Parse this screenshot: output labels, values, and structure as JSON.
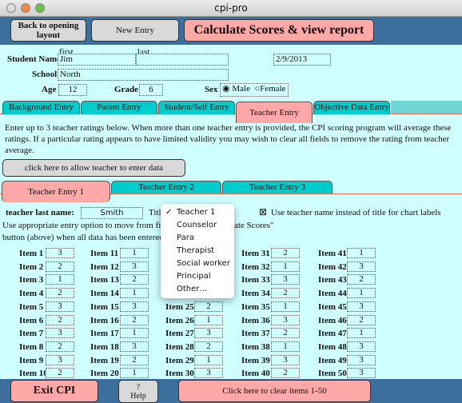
{
  "window": {
    "title": "cpi-pro"
  },
  "toolbar": {
    "back_label": "Back to opening layout",
    "new_label": "New Entry",
    "calc_label": "Calculate Scores & view report"
  },
  "student": {
    "name_label": "Student Name",
    "first_hint": "first",
    "last_hint": "last",
    "first": "Jim",
    "last": "",
    "date": "2/9/2013",
    "school_label": "School",
    "school": "North",
    "age_label": "Age",
    "age": "12",
    "grade_label": "Grade",
    "grade": "6",
    "sex_label": "Sex",
    "sex_options": [
      "Male",
      "Female"
    ],
    "sex_selected": "Male"
  },
  "tabs": [
    "Background Entry",
    "Parent Entry",
    "Student/Self Entry",
    "Teacher Entry",
    "Objective Data Entry"
  ],
  "active_tab": "Teacher Entry",
  "instructions": "Enter up to 3 teacher ratings below.  When more than one teacher entry is provided, the CPI scoring program will average these ratings.  If a particular rating appears to have limited validity you may wish to clear all fields to remove the rating from teacher average.",
  "allow_button": "click here to allow teacher to enter data",
  "subtabs": [
    "Teacher Entry 1",
    "Teacher Entry 2",
    "Teacher Entry 3"
  ],
  "teacher": {
    "last_name_label": "teacher last name:",
    "last_name": "Smith",
    "title_label": "Titl",
    "use_name_checked": true,
    "use_name_label": "Use teacher name instead of title for chart labels",
    "note_line1": "Use appropriate entry option to move from field",
    "note_line1_end": "ate Scores\"",
    "note_line2": "button (above) when all data has been entered."
  },
  "title_dropdown": {
    "selected": "Teacher 1",
    "options": [
      "Teacher 1",
      "Counselor",
      "Para",
      "Therapist",
      "Social worker",
      "Principal",
      "Other…"
    ]
  },
  "items": [
    {
      "label": "Item 1",
      "value": "3"
    },
    {
      "label": "Item 2",
      "value": "2"
    },
    {
      "label": "Item 3",
      "value": "1"
    },
    {
      "label": "Item 4",
      "value": "2"
    },
    {
      "label": "Item 5",
      "value": "3"
    },
    {
      "label": "Item 6",
      "value": "2"
    },
    {
      "label": "Item 7",
      "value": "3"
    },
    {
      "label": "Item 8",
      "value": "2"
    },
    {
      "label": "Item 9",
      "value": "3"
    },
    {
      "label": "Item 10",
      "value": "2"
    },
    {
      "label": "Item 11",
      "value": "1"
    },
    {
      "label": "Item 12",
      "value": "3"
    },
    {
      "label": "Item 13",
      "value": "2"
    },
    {
      "label": "Item 14",
      "value": "1"
    },
    {
      "label": "Item 15",
      "value": "3"
    },
    {
      "label": "Item 16",
      "value": "2"
    },
    {
      "label": "Item 17",
      "value": "1"
    },
    {
      "label": "Item 18",
      "value": "3"
    },
    {
      "label": "Item 19",
      "value": "2"
    },
    {
      "label": "Item 20",
      "value": "1"
    },
    {
      "label": "Item 25",
      "value": "2"
    },
    {
      "label": "Item 26",
      "value": "1"
    },
    {
      "label": "Item 27",
      "value": "3"
    },
    {
      "label": "Item 28",
      "value": "2"
    },
    {
      "label": "Item 29",
      "value": "1"
    },
    {
      "label": "Item 30",
      "value": "3"
    },
    {
      "label": "Item 31",
      "value": "2"
    },
    {
      "label": "Item 32",
      "value": "1"
    },
    {
      "label": "Item 33",
      "value": "3"
    },
    {
      "label": "Item 34",
      "value": "2"
    },
    {
      "label": "Item 35",
      "value": "1"
    },
    {
      "label": "Item 36",
      "value": "3"
    },
    {
      "label": "Item 37",
      "value": "2"
    },
    {
      "label": "Item 38",
      "value": "1"
    },
    {
      "label": "Item 39",
      "value": "3"
    },
    {
      "label": "Item 40",
      "value": "2"
    },
    {
      "label": "Item 41",
      "value": "1"
    },
    {
      "label": "Item 42",
      "value": "3"
    },
    {
      "label": "Item 43",
      "value": "2"
    },
    {
      "label": "Item 44",
      "value": "1"
    },
    {
      "label": "Item 45",
      "value": "3"
    },
    {
      "label": "Item 46",
      "value": "2"
    },
    {
      "label": "Item 47",
      "value": "1"
    },
    {
      "label": "Item 48",
      "value": "3"
    },
    {
      "label": "Item 49",
      "value": "3"
    },
    {
      "label": "Item 50",
      "value": "3"
    }
  ],
  "bottom": {
    "exit_label": "Exit CPI",
    "help_icon": "?",
    "help_label": "Help",
    "clear_label": "Click here to clear items 1-50"
  }
}
